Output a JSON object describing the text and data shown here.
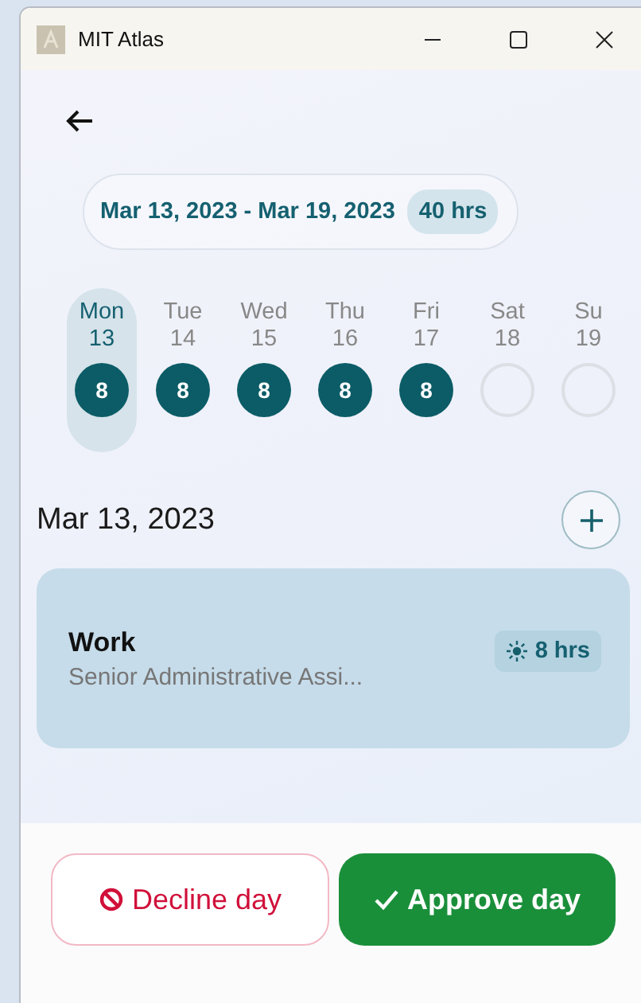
{
  "window": {
    "title": "MIT Atlas"
  },
  "week": {
    "range": "Mar 13, 2023 - Mar 19, 2023",
    "total": "40 hrs"
  },
  "days": [
    {
      "name": "Mon",
      "date": "13",
      "hours": "8",
      "selected": true
    },
    {
      "name": "Tue",
      "date": "14",
      "hours": "8",
      "selected": false
    },
    {
      "name": "Wed",
      "date": "15",
      "hours": "8",
      "selected": false
    },
    {
      "name": "Thu",
      "date": "16",
      "hours": "8",
      "selected": false
    },
    {
      "name": "Fri",
      "date": "17",
      "hours": "8",
      "selected": false
    },
    {
      "name": "Sat",
      "date": "18",
      "selected": false
    },
    {
      "name": "Su",
      "date": "19",
      "selected": false
    }
  ],
  "day_heading": "Mar 13, 2023",
  "entries": [
    {
      "title": "Work",
      "subtitle": "Senior Administrative Assi...",
      "hours": "8 hrs"
    }
  ],
  "buttons": [
    {
      "kind": "decline",
      "label": "Decline day"
    },
    {
      "kind": "approve",
      "label": "Approve day"
    }
  ]
}
